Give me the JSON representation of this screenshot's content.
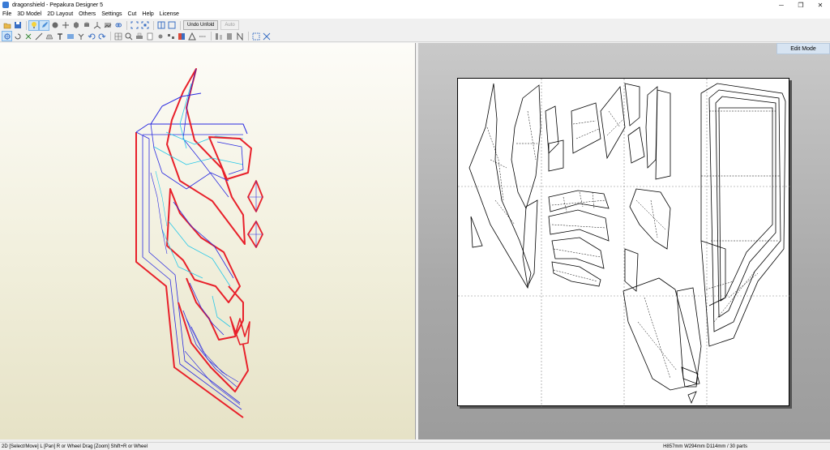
{
  "window": {
    "title": "dragonshield - Pepakura Designer 5",
    "controls": [
      "─",
      "❐",
      "✕"
    ]
  },
  "menu": [
    "File",
    "3D Model",
    "2D Layout",
    "Others",
    "Settings",
    "Cut",
    "Help",
    "License"
  ],
  "toolbar1": {
    "icons": [
      "open-icon",
      "save-icon",
      "light-icon",
      "edit-icon",
      "paint-icon",
      "move-icon",
      "model-icon",
      "cylinder-icon",
      "axis-icon",
      "texture-icon",
      "link-icon",
      "fit-icon",
      "fit-all-icon",
      "layout-icon",
      "window-icon"
    ],
    "undo_unfold_label": "Undo Unfold",
    "auto_label": "Auto"
  },
  "toolbar2": {
    "icons": [
      "select-icon",
      "rotate-icon",
      "cut-icon",
      "line-icon",
      "flap-icon",
      "text-icon",
      "image-icon",
      "join-icon",
      "undo-icon",
      "redo-icon",
      "grid-icon",
      "zoom-icon",
      "print-icon",
      "page-icon",
      "settings-icon",
      "layout-icon",
      "color-icon",
      "pattern-icon",
      "edge-icon",
      "pieces-icon",
      "arrange-icon",
      "fold-icon",
      "num-icon",
      "align-icon",
      "overlap-icon"
    ]
  },
  "view2d": {
    "edit_mode_label": "Edit Mode"
  },
  "status": {
    "left": "2D [Select/Move] L [Pan] R or Wheel Drag [Zoom] Shift+R or Wheel",
    "right": "H857mm W294mm D114mm / 30 parts"
  },
  "colors": {
    "model_outline": "#e8202a",
    "model_edge": "#2a2ae0",
    "model_fold": "#28c8e8",
    "paper_line": "#000000"
  }
}
